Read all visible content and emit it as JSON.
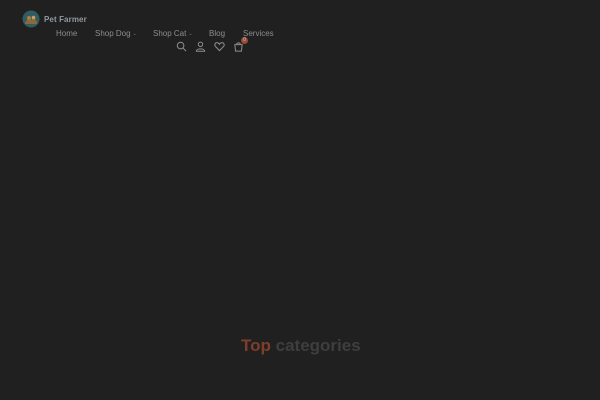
{
  "brand": {
    "name": "Pet Farmer"
  },
  "nav": {
    "items": [
      {
        "label": "Home",
        "has_dropdown": false
      },
      {
        "label": "Shop Dog",
        "has_dropdown": true
      },
      {
        "label": "Shop Cat",
        "has_dropdown": true
      },
      {
        "label": "Blog",
        "has_dropdown": false
      },
      {
        "label": "Services",
        "has_dropdown": false
      }
    ]
  },
  "header_icons": {
    "search": {
      "icon": "search-icon"
    },
    "account": {
      "icon": "user-icon"
    },
    "wishlist": {
      "icon": "heart-icon"
    },
    "cart": {
      "icon": "cart-icon",
      "badge": "0"
    }
  },
  "section": {
    "title_accent": "Top",
    "title_rest": "categories"
  },
  "colors": {
    "background": "#202020",
    "accent": "#7d3f2c",
    "badge": "#9a4a35"
  }
}
